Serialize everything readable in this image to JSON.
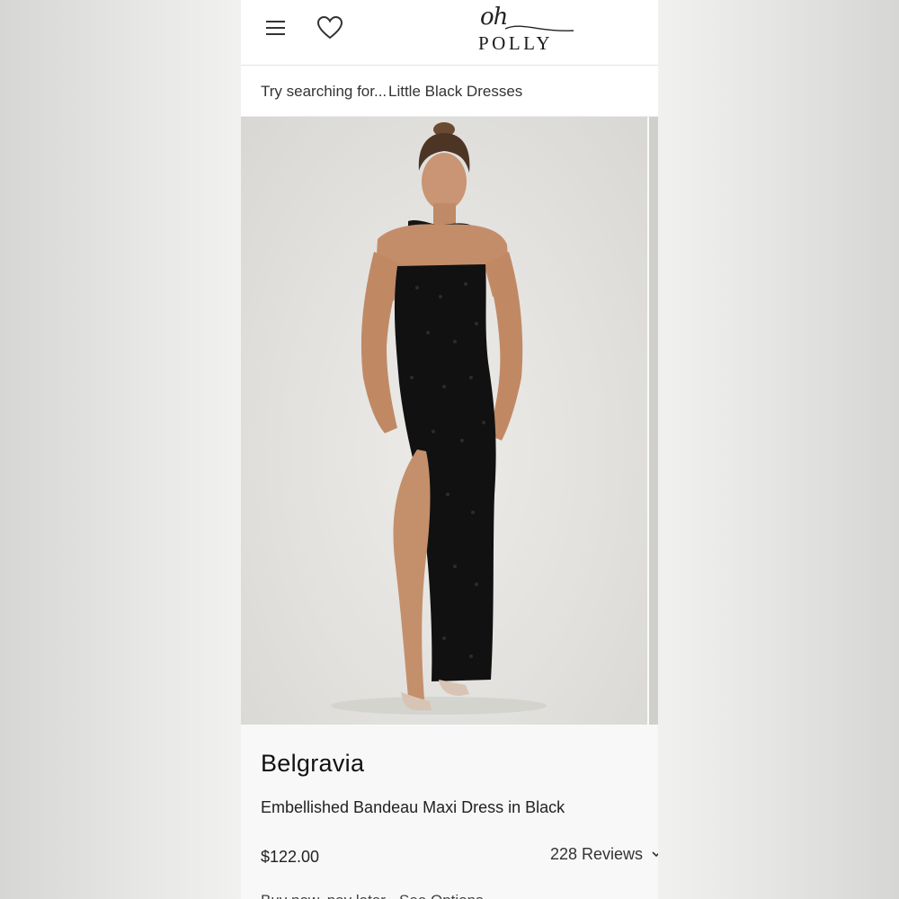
{
  "header": {
    "menu_icon": "hamburger-menu-icon",
    "wishlist_icon": "heart-icon",
    "logo_script": "oh",
    "logo_word": "POLLY"
  },
  "search": {
    "prefix": "Try searching for...",
    "suggestion": "Little Black Dresses"
  },
  "product": {
    "name": "Belgravia",
    "description": "Embellished Bandeau Maxi Dress in Black",
    "price": "$122.00",
    "reviews": "228 Reviews",
    "cutoff_text": "Buy now, pay later · See Options"
  },
  "colors": {
    "background_side": "#e9e9e7",
    "page": "#ffffff",
    "info_panel": "#f8f8f8",
    "text": "#1a1a1a",
    "dress": "#111111"
  }
}
